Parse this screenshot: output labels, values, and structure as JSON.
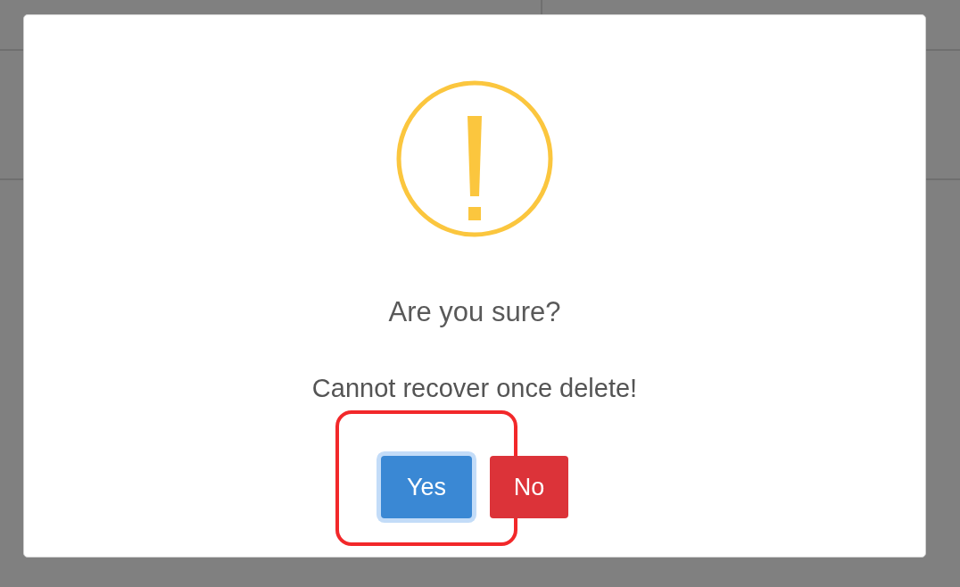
{
  "dialog": {
    "kind": "warning",
    "title": "Are you sure?",
    "message": "Cannot recover once delete!",
    "buttons": [
      {
        "label": "Yes",
        "kind": "confirm",
        "focused": true,
        "highlighted": true
      },
      {
        "label": "No",
        "kind": "cancel",
        "focused": false,
        "highlighted": false
      }
    ]
  }
}
